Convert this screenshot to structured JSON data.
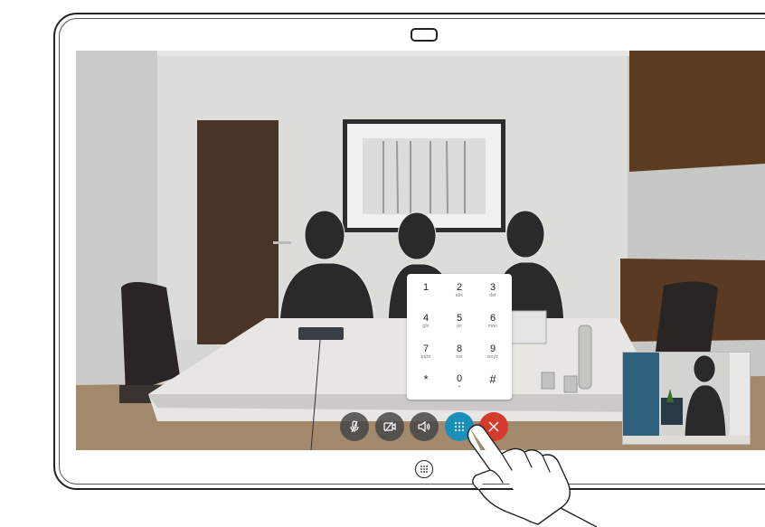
{
  "keypad": {
    "keys": [
      {
        "digit": "1",
        "letters": ""
      },
      {
        "digit": "2",
        "letters": "abc"
      },
      {
        "digit": "3",
        "letters": "def"
      },
      {
        "digit": "4",
        "letters": "ghi"
      },
      {
        "digit": "5",
        "letters": "jkl"
      },
      {
        "digit": "6",
        "letters": "mno"
      },
      {
        "digit": "7",
        "letters": "pqrs"
      },
      {
        "digit": "8",
        "letters": "tuv"
      },
      {
        "digit": "9",
        "letters": "wxyz"
      },
      {
        "digit": "*",
        "letters": ""
      },
      {
        "digit": "0",
        "letters": "+"
      },
      {
        "digit": "#",
        "letters": ""
      }
    ]
  },
  "controls": [
    {
      "name": "mute-button",
      "icon": "microphone-muted-icon"
    },
    {
      "name": "camera-off-button",
      "icon": "camera-muted-icon"
    },
    {
      "name": "volume-button",
      "icon": "speaker-icon"
    },
    {
      "name": "keypad-button",
      "icon": "dialpad-icon"
    },
    {
      "name": "end-call-button",
      "icon": "close-icon"
    }
  ],
  "colors": {
    "keypad_button": "#1b8fb7",
    "end_call": "#d43b2d",
    "control_dark": "#464646"
  }
}
